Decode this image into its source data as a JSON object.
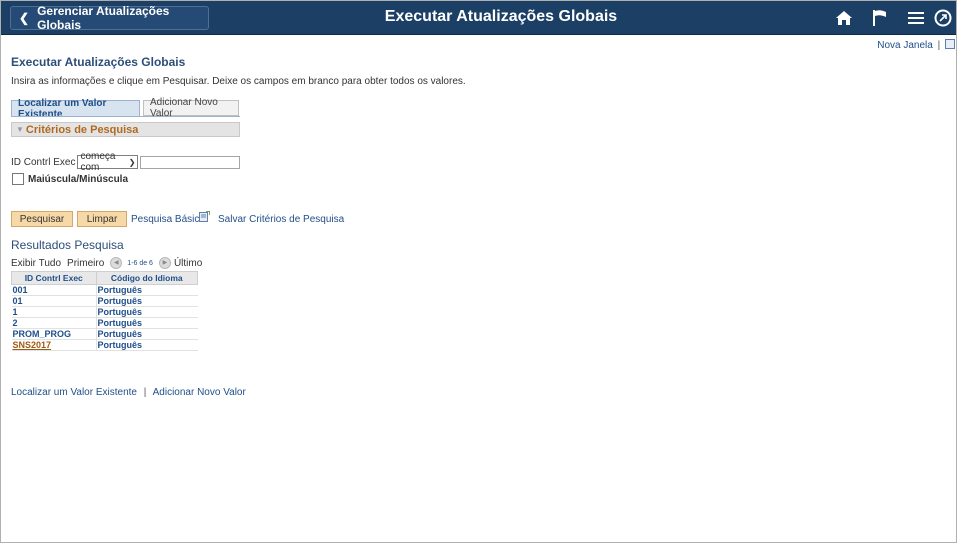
{
  "header": {
    "back_label": "Gerenciar Atualizações Globais",
    "title": "Executar Atualizações Globais",
    "icons": [
      "home-icon",
      "flag-icon",
      "menu-icon",
      "navbar-icon"
    ]
  },
  "new_window": {
    "label": "Nova Janela",
    "separator": "|"
  },
  "page": {
    "title": "Executar Atualizações Globais",
    "instructions": "Insira as informações e clique em Pesquisar. Deixe os campos em branco para obter todos os valores."
  },
  "tabs": {
    "find": "Localizar um Valor Existente",
    "add": "Adicionar Novo Valor"
  },
  "criteria": {
    "group_title": "Critérios de Pesquisa",
    "field_label": "ID Contrl Exec",
    "operator": "começa com",
    "value": "",
    "case_label": "Maiúscula/Minúscula"
  },
  "actions": {
    "search": "Pesquisar",
    "clear": "Limpar",
    "basic_search": "Pesquisa Básica",
    "save_criteria": "Salvar Critérios de Pesquisa"
  },
  "results": {
    "title": "Resultados Pesquisa",
    "view_all": "Exibir Tudo",
    "first": "Primeiro",
    "count": "1-6 de 6",
    "last": "Último",
    "columns": [
      "ID Contrl Exec",
      "Código do Idioma"
    ],
    "rows": [
      [
        "001",
        "Português"
      ],
      [
        "01",
        "Português"
      ],
      [
        "1",
        "Português"
      ],
      [
        "2",
        "Português"
      ],
      [
        "PROM_PROG",
        "Português"
      ],
      [
        "SNS2017",
        "Português"
      ]
    ]
  },
  "footer_links": {
    "find": "Localizar um Valor Existente",
    "separator": "|",
    "add": "Adicionar Novo Valor"
  },
  "colors": {
    "header_bg": "#1c3f66",
    "link": "#1f4f8a",
    "button_bg": "#f7d9a8",
    "group_text": "#b06a20"
  }
}
